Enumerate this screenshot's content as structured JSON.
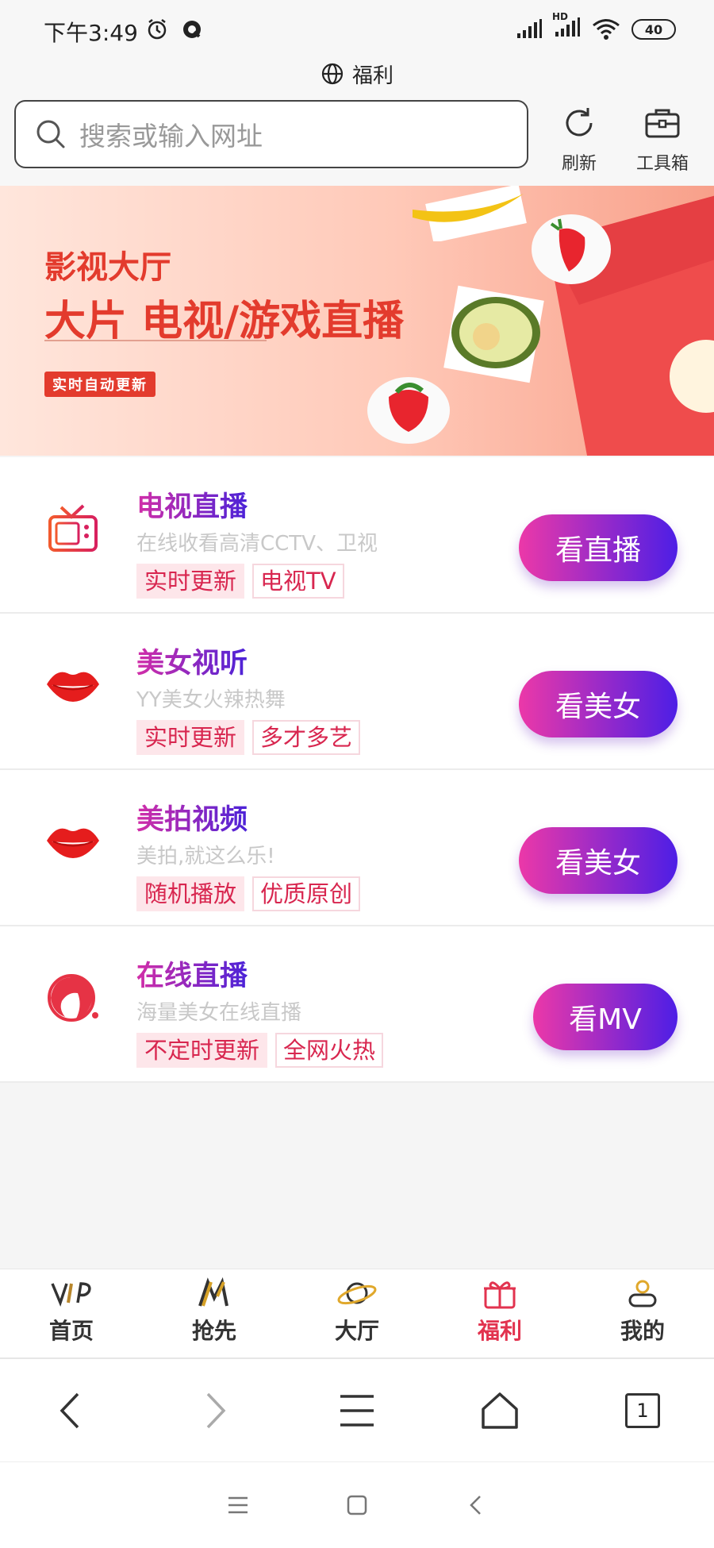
{
  "status_bar": {
    "time": "下午3:49",
    "network": "HD",
    "battery": "40"
  },
  "page_title": "福利",
  "search": {
    "placeholder": "搜索或输入网址"
  },
  "toolbar": {
    "refresh_label": "刷新",
    "toolbox_label": "工具箱"
  },
  "banner": {
    "title_line1": "影视大厅",
    "title_line2": "大片 电视/游戏直播",
    "tag": "实时自动更新"
  },
  "items": [
    {
      "title": "电视直播",
      "subtitle": "在线收看高清CCTV、卫视",
      "tag1": "实时更新",
      "tag2": "电视TV",
      "button": "看直播",
      "icon": "tv-icon"
    },
    {
      "title": "美女视听",
      "subtitle": "YY美女火辣热舞",
      "tag1": "实时更新",
      "tag2": "多才多艺",
      "button": "看美女",
      "icon": "lips-icon"
    },
    {
      "title": "美拍视频",
      "subtitle": "美拍,就这么乐!",
      "tag1": "随机播放",
      "tag2": "优质原创",
      "button": "看美女",
      "icon": "lips-icon"
    },
    {
      "title": "在线直播",
      "subtitle": "海量美女在线直播",
      "tag1": "不定时更新",
      "tag2": "全网火热",
      "button": "看MV",
      "icon": "girl-icon"
    }
  ],
  "bottom_tabs": [
    {
      "label": "首页",
      "icon": "vip-icon"
    },
    {
      "label": "抢先",
      "icon": "m-icon"
    },
    {
      "label": "大厅",
      "icon": "planet-icon"
    },
    {
      "label": "福利",
      "icon": "gift-icon",
      "active": true
    },
    {
      "label": "我的",
      "icon": "person-icon"
    }
  ],
  "browser_nav": {
    "tabs_count": "1"
  },
  "colors": {
    "accent": "#e2334f",
    "gradient_start": "#ec38a8",
    "gradient_end": "#4d1ee6"
  }
}
